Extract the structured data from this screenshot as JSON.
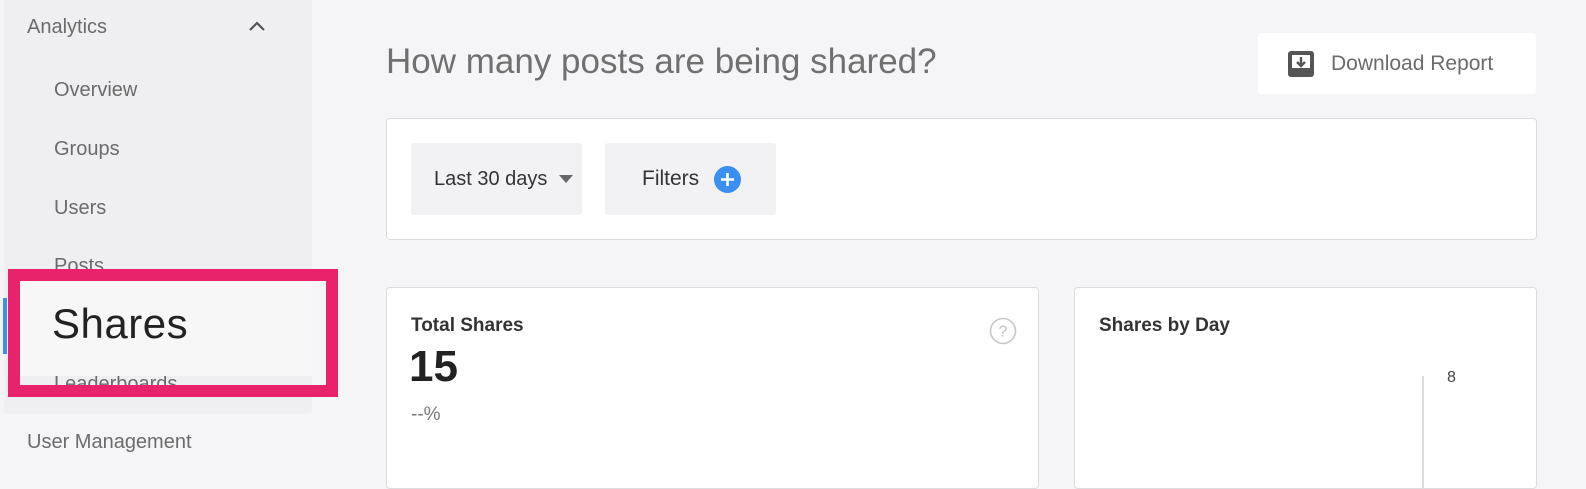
{
  "sidebar": {
    "section_title": "Analytics",
    "items": [
      {
        "label": "Overview"
      },
      {
        "label": "Groups"
      },
      {
        "label": "Users"
      },
      {
        "label": "Posts"
      },
      {
        "label": "Shares"
      },
      {
        "label": "Leaderboards"
      }
    ],
    "active_item": "Shares",
    "user_management": "User Management"
  },
  "header": {
    "title": "How many posts are being shared?",
    "download_label": "Download Report"
  },
  "filters": {
    "range_label": "Last 30 days",
    "filters_label": "Filters"
  },
  "stat": {
    "title": "Total Shares",
    "value": "15",
    "change": "--%"
  },
  "chart": {
    "title": "Shares by Day"
  },
  "chart_data": {
    "type": "bar",
    "title": "Shares by Day",
    "ytick_labels": [
      "8"
    ]
  },
  "colors": {
    "accent": "#3b8ff0",
    "highlight": "#e8226b"
  }
}
